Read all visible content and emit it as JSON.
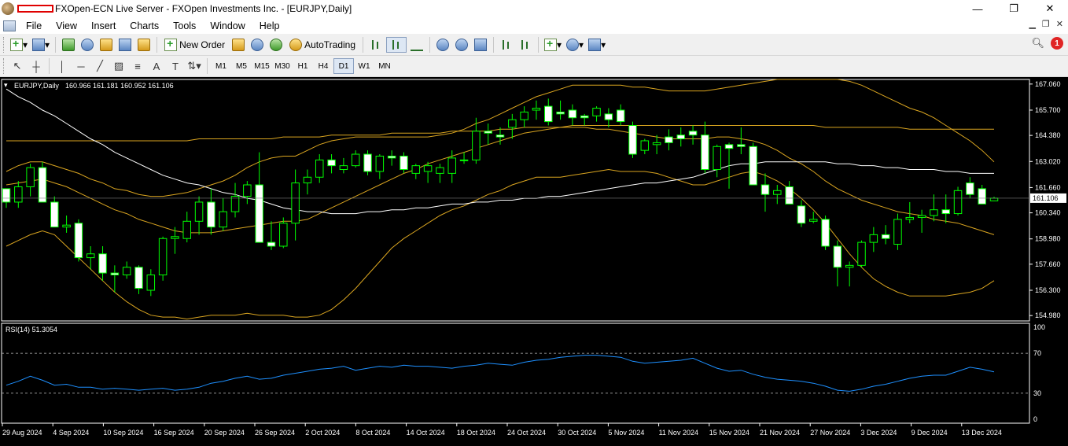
{
  "window": {
    "title": "FXOpen-ECN Live Server - FXOpen Investments Inc. - [EURJPY,Daily]",
    "controls": {
      "minimize": "—",
      "maximize": "❐",
      "close": "✕"
    }
  },
  "menu": {
    "items": [
      "File",
      "View",
      "Insert",
      "Charts",
      "Tools",
      "Window",
      "Help"
    ]
  },
  "toolbar": {
    "new_order": "New Order",
    "autotrading": "AutoTrading",
    "notification_count": "1"
  },
  "timeframes": {
    "items": [
      "M1",
      "M5",
      "M15",
      "M30",
      "H1",
      "H4",
      "D1",
      "W1",
      "MN"
    ],
    "active": "D1"
  },
  "chart_data": {
    "type": "candlestick",
    "symbol_label": "EURJPY,Daily",
    "ohlc_label": "160.966 161.181 160.952 161.106",
    "current_price": "161.106",
    "ylim": [
      154.7,
      167.3
    ],
    "y_ticks": [
      "167.060",
      "165.700",
      "164.380",
      "163.020",
      "161.660",
      "160.340",
      "158.980",
      "157.660",
      "156.300",
      "154.980"
    ],
    "x_ticks": [
      "29 Aug 2024",
      "4 Sep 2024",
      "10 Sep 2024",
      "16 Sep 2024",
      "20 Sep 2024",
      "26 Sep 2024",
      "2 Oct 2024",
      "8 Oct 2024",
      "14 Oct 2024",
      "18 Oct 2024",
      "24 Oct 2024",
      "30 Oct 2024",
      "5 Nov 2024",
      "11 Nov 2024",
      "15 Nov 2024",
      "21 Nov 2024",
      "27 Nov 2024",
      "3 Dec 2024",
      "9 Dec 2024",
      "13 Dec 2024"
    ],
    "colors": {
      "bull": "#00ff00",
      "bear": "#ffffff",
      "band": "#daa520",
      "ma": "#ffffff",
      "rsi": "#1e90ff"
    },
    "candles": [
      [
        161.6,
        161.4,
        160.6,
        160.9
      ],
      [
        160.9,
        162.0,
        160.6,
        161.7
      ],
      [
        161.7,
        162.9,
        161.2,
        162.7
      ],
      [
        162.7,
        163.0,
        161.2,
        160.9
      ],
      [
        160.9,
        161.2,
        159.6,
        159.6
      ],
      [
        159.6,
        160.2,
        159.3,
        159.7
      ],
      [
        159.8,
        160.0,
        157.8,
        158.0
      ],
      [
        158.0,
        158.6,
        157.4,
        158.2
      ],
      [
        158.2,
        158.6,
        156.8,
        157.2
      ],
      [
        157.2,
        157.6,
        156.2,
        157.1
      ],
      [
        157.1,
        157.8,
        156.9,
        157.5
      ],
      [
        157.5,
        157.6,
        156.1,
        156.4
      ],
      [
        156.3,
        157.4,
        156.0,
        157.1
      ],
      [
        157.1,
        159.1,
        156.8,
        159.0
      ],
      [
        159.0,
        159.6,
        158.2,
        159.1
      ],
      [
        159.0,
        160.4,
        158.8,
        159.9
      ],
      [
        159.9,
        161.2,
        159.2,
        160.9
      ],
      [
        160.9,
        161.6,
        159.2,
        159.6
      ],
      [
        159.6,
        161.1,
        159.4,
        160.4
      ],
      [
        160.4,
        161.9,
        160.1,
        161.2
      ],
      [
        161.2,
        162.0,
        160.8,
        161.8
      ],
      [
        161.8,
        163.5,
        158.8,
        158.8
      ],
      [
        158.8,
        159.9,
        158.4,
        158.6
      ],
      [
        158.6,
        160.1,
        158.5,
        159.8
      ],
      [
        159.8,
        162.6,
        158.9,
        161.9
      ],
      [
        161.9,
        162.6,
        161.3,
        162.2
      ],
      [
        162.2,
        163.4,
        161.9,
        163.1
      ],
      [
        163.1,
        163.4,
        162.4,
        162.8
      ],
      [
        162.6,
        163.2,
        162.4,
        162.8
      ],
      [
        162.8,
        163.6,
        162.7,
        163.4
      ],
      [
        163.4,
        163.6,
        162.3,
        162.5
      ],
      [
        162.5,
        163.4,
        162.1,
        163.3
      ],
      [
        163.3,
        163.6,
        162.8,
        163.2
      ],
      [
        163.3,
        163.5,
        162.4,
        162.6
      ],
      [
        162.4,
        162.9,
        162.1,
        162.8
      ],
      [
        162.5,
        163.0,
        161.9,
        162.8
      ],
      [
        162.4,
        162.9,
        161.9,
        162.7
      ],
      [
        162.4,
        163.6,
        161.9,
        163.2
      ],
      [
        163.1,
        163.5,
        162.9,
        163.1
      ],
      [
        163.1,
        165.3,
        162.9,
        164.6
      ],
      [
        164.6,
        165.0,
        163.9,
        164.5
      ],
      [
        164.4,
        164.8,
        163.9,
        164.3
      ],
      [
        164.8,
        165.5,
        164.2,
        165.2
      ],
      [
        165.2,
        165.9,
        164.8,
        165.6
      ],
      [
        165.7,
        166.2,
        165.2,
        165.8
      ],
      [
        165.9,
        166.3,
        164.9,
        165.1
      ],
      [
        165.6,
        166.2,
        165.2,
        165.5
      ],
      [
        165.7,
        166.0,
        164.9,
        165.3
      ],
      [
        165.4,
        165.5,
        164.9,
        165.3
      ],
      [
        165.4,
        165.9,
        165.1,
        165.8
      ],
      [
        165.5,
        165.8,
        164.8,
        165.2
      ],
      [
        165.7,
        166.0,
        164.9,
        165.1
      ],
      [
        164.9,
        165.1,
        163.2,
        163.4
      ],
      [
        163.6,
        164.2,
        163.4,
        164.1
      ],
      [
        163.9,
        164.4,
        163.4,
        164.0
      ],
      [
        164.3,
        164.7,
        163.6,
        164.0
      ],
      [
        164.4,
        164.8,
        163.8,
        164.2
      ],
      [
        164.6,
        164.9,
        163.9,
        164.4
      ],
      [
        164.4,
        165.1,
        162.4,
        162.6
      ],
      [
        162.6,
        163.9,
        162.2,
        163.8
      ],
      [
        163.9,
        164.0,
        161.6,
        163.7
      ],
      [
        163.9,
        164.8,
        163.4,
        163.8
      ],
      [
        163.8,
        164.0,
        162.9,
        161.8
      ],
      [
        161.8,
        162.4,
        160.4,
        161.3
      ],
      [
        161.3,
        161.8,
        160.8,
        161.5
      ],
      [
        161.7,
        162.0,
        160.9,
        160.8
      ],
      [
        160.7,
        161.0,
        159.6,
        159.8
      ],
      [
        159.9,
        160.4,
        159.8,
        160.0
      ],
      [
        160.0,
        160.2,
        158.4,
        158.6
      ],
      [
        158.6,
        158.9,
        156.5,
        157.5
      ],
      [
        157.5,
        157.8,
        156.5,
        157.6
      ],
      [
        157.6,
        158.9,
        157.5,
        158.8
      ],
      [
        158.8,
        159.6,
        158.3,
        159.2
      ],
      [
        159.2,
        159.7,
        158.7,
        159.0
      ],
      [
        158.7,
        160.3,
        158.4,
        160.0
      ],
      [
        160.0,
        160.9,
        159.8,
        160.1
      ],
      [
        160.1,
        160.5,
        159.3,
        160.2
      ],
      [
        160.2,
        161.3,
        159.9,
        160.5
      ],
      [
        160.5,
        161.3,
        159.8,
        160.3
      ],
      [
        160.3,
        161.7,
        160.2,
        161.5
      ],
      [
        161.9,
        162.2,
        161.1,
        161.3
      ],
      [
        161.6,
        161.8,
        160.9,
        160.8
      ],
      [
        160.966,
        161.181,
        160.952,
        161.106
      ]
    ],
    "ma_upper": [
      164.1,
      164.1,
      164.1,
      164.1,
      164.1,
      164.1,
      164.1,
      164.1,
      164.1,
      164.1,
      164.1,
      164.1,
      164.1,
      164.1,
      164.1,
      164.1,
      164.2,
      164.2,
      164.2,
      164.2,
      164.2,
      164.2,
      164.2,
      164.3,
      164.3,
      164.3,
      164.3,
      164.4,
      164.4,
      164.4,
      164.4,
      164.4,
      164.5,
      164.5,
      164.5,
      164.5,
      164.5,
      164.6,
      164.6,
      164.6,
      164.6,
      164.7,
      164.7,
      164.8,
      164.8,
      164.8,
      164.8,
      164.9,
      164.9,
      164.9,
      164.9,
      164.9,
      164.9,
      164.9,
      164.9,
      164.9,
      164.9,
      164.9,
      164.9,
      164.9,
      164.9,
      164.9,
      164.9,
      164.9,
      164.9,
      164.9,
      164.9,
      164.9,
      164.8,
      164.8,
      164.8,
      164.8,
      164.8,
      164.8,
      164.8,
      164.7,
      164.7,
      164.7,
      164.7,
      164.7,
      164.7,
      164.7,
      164.7
    ],
    "ma_mid": [
      166.8,
      166.4,
      166.1,
      165.7,
      165.4,
      165.0,
      164.6,
      164.2,
      163.9,
      163.5,
      163.2,
      162.9,
      162.6,
      162.3,
      162.1,
      161.9,
      161.8,
      161.6,
      161.4,
      161.3,
      161.1,
      161.0,
      160.8,
      160.6,
      160.5,
      160.4,
      160.4,
      160.3,
      160.3,
      160.3,
      160.4,
      160.4,
      160.5,
      160.5,
      160.6,
      160.6,
      160.7,
      160.8,
      160.8,
      160.9,
      160.9,
      161.0,
      161.0,
      161.1,
      161.1,
      161.2,
      161.2,
      161.3,
      161.4,
      161.5,
      161.6,
      161.7,
      161.8,
      161.9,
      161.9,
      162.0,
      162.1,
      162.2,
      162.4,
      162.6,
      162.8,
      162.9,
      162.9,
      163.0,
      163.0,
      163.0,
      163.0,
      163.0,
      163.0,
      162.9,
      162.9,
      162.8,
      162.8,
      162.7,
      162.7,
      162.6,
      162.6,
      162.6,
      162.5,
      162.5,
      162.4,
      162.4,
      162.4
    ],
    "bb_upper": [
      162.5,
      162.8,
      163.0,
      163.0,
      162.8,
      162.6,
      162.4,
      162.1,
      161.9,
      161.6,
      161.5,
      161.3,
      161.2,
      161.2,
      161.3,
      161.4,
      161.6,
      161.8,
      162.0,
      162.3,
      162.7,
      163.0,
      163.2,
      163.3,
      163.3,
      163.6,
      163.9,
      164.1,
      164.2,
      164.3,
      164.3,
      164.3,
      164.3,
      164.3,
      164.3,
      164.3,
      164.4,
      164.5,
      164.7,
      165.0,
      165.2,
      165.5,
      165.8,
      166.1,
      166.4,
      166.6,
      166.8,
      167.0,
      167.0,
      167.0,
      167.0,
      167.0,
      166.9,
      166.9,
      166.8,
      166.7,
      166.7,
      166.7,
      166.7,
      166.8,
      166.9,
      167.0,
      167.1,
      167.2,
      167.3,
      167.3,
      167.3,
      167.3,
      167.3,
      167.3,
      167.2,
      167.0,
      166.7,
      166.4,
      166.1,
      165.8,
      165.6,
      165.3,
      164.9,
      164.5,
      164.1,
      163.6,
      163.0
    ],
    "bb_lower": [
      158.6,
      158.9,
      159.2,
      159.4,
      159.2,
      158.6,
      158.0,
      157.4,
      156.8,
      156.2,
      155.7,
      155.3,
      155.0,
      154.9,
      154.9,
      154.8,
      154.9,
      155.0,
      155.0,
      155.0,
      155.1,
      155.0,
      155.0,
      155.0,
      154.9,
      154.9,
      155.0,
      155.3,
      155.8,
      156.4,
      157.1,
      157.8,
      158.5,
      159.0,
      159.4,
      159.8,
      160.2,
      160.5,
      160.7,
      161.0,
      161.3,
      161.5,
      161.8,
      162.0,
      162.2,
      162.2,
      162.2,
      162.3,
      162.4,
      162.5,
      162.6,
      162.5,
      162.5,
      162.5,
      162.4,
      162.2,
      162.0,
      161.8,
      161.8,
      162.0,
      162.2,
      162.4,
      162.5,
      162.3,
      162.0,
      161.6,
      161.1,
      160.5,
      159.8,
      159.0,
      158.2,
      157.5,
      156.9,
      156.5,
      156.2,
      156.0,
      156.0,
      156.0,
      156.0,
      156.1,
      156.2,
      156.4,
      156.8
    ],
    "bb_mid": [
      161.8,
      161.9,
      162.0,
      162.1,
      161.9,
      161.7,
      161.4,
      161.1,
      160.8,
      160.5,
      160.3,
      160.0,
      159.8,
      159.6,
      159.4,
      159.3,
      159.3,
      159.3,
      159.4,
      159.5,
      159.6,
      159.7,
      159.8,
      159.9,
      159.9,
      160.0,
      160.3,
      160.6,
      160.9,
      161.2,
      161.5,
      161.8,
      162.1,
      162.4,
      162.6,
      162.9,
      163.1,
      163.3,
      163.5,
      163.7,
      163.9,
      164.1,
      164.3,
      164.5,
      164.6,
      164.7,
      164.8,
      164.8,
      164.8,
      164.7,
      164.7,
      164.6,
      164.5,
      164.4,
      164.3,
      164.2,
      164.2,
      164.2,
      164.2,
      164.3,
      164.3,
      164.2,
      164.1,
      163.9,
      163.6,
      163.2,
      162.9,
      162.5,
      162.0,
      161.6,
      161.3,
      161.0,
      160.8,
      160.6,
      160.4,
      160.3,
      160.2,
      160.0,
      159.9,
      159.8,
      159.6,
      159.4,
      159.2
    ],
    "rsi": {
      "label": "RSI(14) 51.3054",
      "levels_label": [
        "100",
        "70",
        "30",
        "0"
      ],
      "level_lines": [
        70,
        30
      ],
      "ylim": [
        0,
        100
      ],
      "values": [
        38,
        42,
        47,
        43,
        38,
        39,
        36,
        36,
        34,
        35,
        34,
        33,
        34,
        35,
        33,
        34,
        36,
        40,
        42,
        45,
        47,
        44,
        45,
        48,
        50,
        52,
        54,
        55,
        57,
        53,
        55,
        57,
        56,
        58,
        57,
        57,
        56,
        55,
        57,
        58,
        60,
        59,
        58,
        61,
        63,
        64,
        66,
        67,
        68,
        68,
        67,
        66,
        62,
        60,
        61,
        62,
        63,
        65,
        60,
        55,
        52,
        53,
        49,
        46,
        44,
        43,
        42,
        40,
        37,
        33,
        32,
        34,
        37,
        39,
        42,
        45,
        47,
        48,
        48,
        52,
        56,
        54,
        51.3
      ]
    }
  }
}
